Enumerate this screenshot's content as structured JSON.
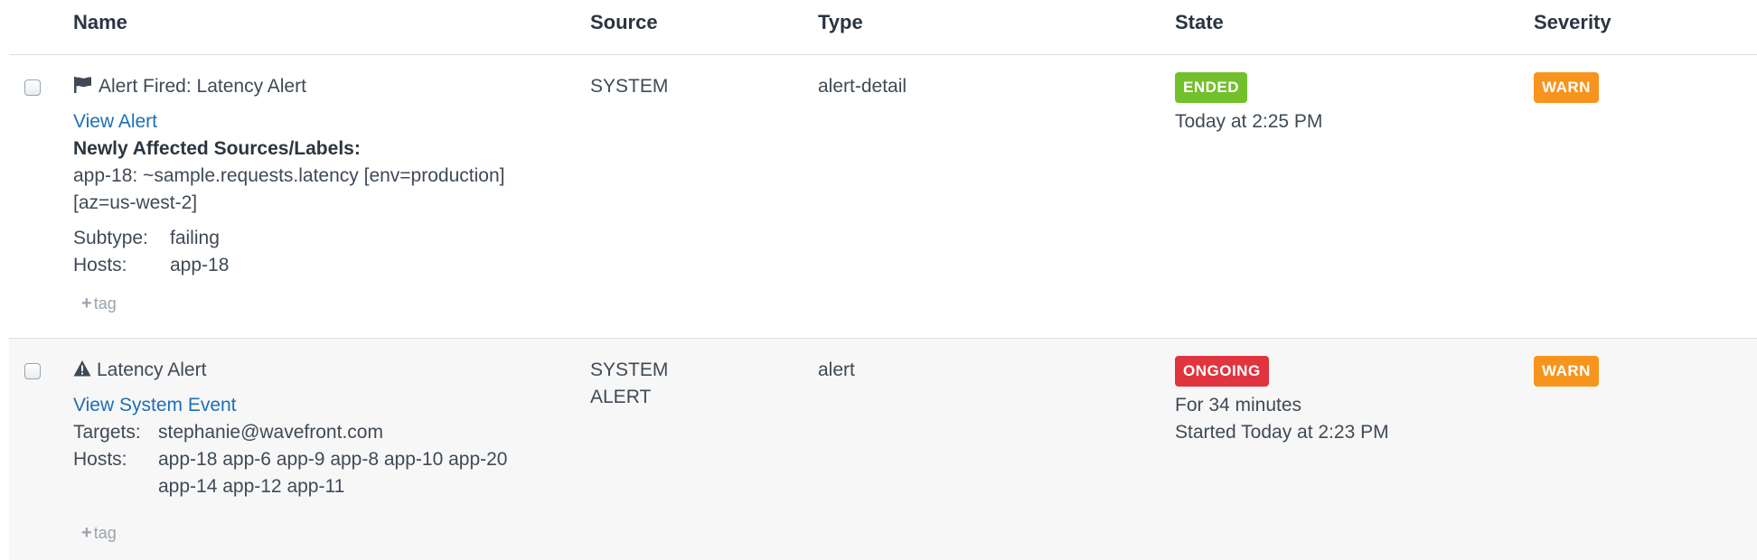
{
  "columns": {
    "name": "Name",
    "source": "Source",
    "type": "Type",
    "state": "State",
    "severity": "Severity"
  },
  "colors": {
    "ended": "#72c02c",
    "ongoing": "#e0353f",
    "warn": "#f7941d",
    "link": "#1d6fb8"
  },
  "rows": [
    {
      "icon": "flag-icon",
      "title": "Alert Fired: Latency Alert",
      "link": "View Alert",
      "affected_heading": "Newly Affected Sources/Labels:",
      "affected_line1": "app-18: ~sample.requests.latency [env=production]",
      "affected_line2": "[az=us-west-2]",
      "subtype_label": "Subtype:",
      "subtype_value": "failing",
      "hosts_label": "Hosts:",
      "hosts_value": "app-18",
      "tag": "tag",
      "source": "SYSTEM",
      "type": "alert-detail",
      "state": "ENDED",
      "state_time": "Today at 2:25 PM",
      "severity": "WARN"
    },
    {
      "icon": "warning-icon",
      "title": "Latency Alert",
      "link": "View System Event",
      "targets_label": "Targets:",
      "targets_value": "stephanie@wavefront.com",
      "hosts_label": "Hosts:",
      "hosts_line1": "app-18 app-6 app-9 app-8 app-10 app-20",
      "hosts_line2": "app-14 app-12 app-11",
      "tag": "tag",
      "source_line1": "SYSTEM",
      "source_line2": "ALERT",
      "type": "alert",
      "state": "ONGOING",
      "state_duration": "For 34 minutes",
      "state_started": "Started Today at 2:23 PM",
      "severity": "WARN"
    }
  ]
}
